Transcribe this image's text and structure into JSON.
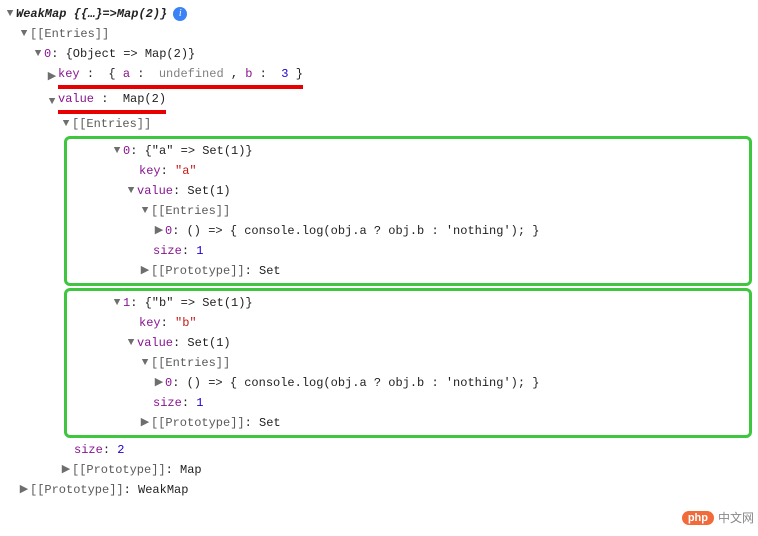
{
  "root": {
    "type": "WeakMap",
    "summary_open": "{{…}",
    "summary_mid": " => ",
    "summary_close": "Map(2)}"
  },
  "entriesLabel": "[[Entries]]",
  "protoLabel": "[[Prototype]]",
  "sizeLabel": "size",
  "entry0": {
    "idx": "0",
    "summary": "{Object => Map(2)}",
    "key": {
      "label": "key",
      "open": "{",
      "a_name": "a",
      "a_val": "undefined",
      "sep": ", ",
      "b_name": "b",
      "b_val": "3",
      "close": "}"
    },
    "value": {
      "label": "value",
      "summary": "Map(2)"
    }
  },
  "inner0": {
    "idx": "0",
    "summary": "{\"a\" => Set(1)}",
    "keyLabel": "key",
    "keyVal": "\"a\"",
    "valueLabel": "value",
    "valueSummary": "Set(1)",
    "setEntryIdx": "0",
    "setEntryVal": "() => { console.log(obj.a ? obj.b : 'nothing'); }",
    "size": "1",
    "protoVal": "Set"
  },
  "inner1": {
    "idx": "1",
    "summary": "{\"b\" => Set(1)}",
    "keyLabel": "key",
    "keyVal": "\"b\"",
    "valueLabel": "value",
    "valueSummary": "Set(1)",
    "setEntryIdx": "0",
    "setEntryVal": "() => { console.log(obj.a ? obj.b : 'nothing'); }",
    "size": "1",
    "protoVal": "Set"
  },
  "mapSize": "2",
  "mapProtoVal": "Map",
  "rootProtoVal": "WeakMap",
  "watermark": {
    "logo": "php",
    "text": "中文网"
  }
}
